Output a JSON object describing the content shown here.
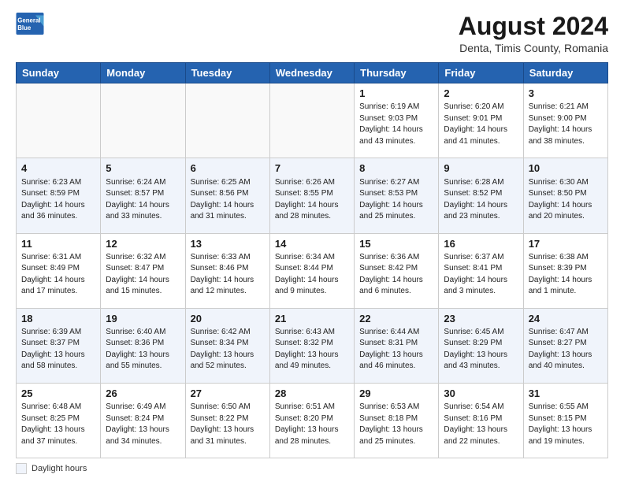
{
  "header": {
    "logo_line1": "General",
    "logo_line2": "Blue",
    "main_title": "August 2024",
    "subtitle": "Denta, Timis County, Romania"
  },
  "calendar": {
    "days_of_week": [
      "Sunday",
      "Monday",
      "Tuesday",
      "Wednesday",
      "Thursday",
      "Friday",
      "Saturday"
    ],
    "weeks": [
      [
        {
          "day": "",
          "info": ""
        },
        {
          "day": "",
          "info": ""
        },
        {
          "day": "",
          "info": ""
        },
        {
          "day": "",
          "info": ""
        },
        {
          "day": "1",
          "info": "Sunrise: 6:19 AM\nSunset: 9:03 PM\nDaylight: 14 hours\nand 43 minutes."
        },
        {
          "day": "2",
          "info": "Sunrise: 6:20 AM\nSunset: 9:01 PM\nDaylight: 14 hours\nand 41 minutes."
        },
        {
          "day": "3",
          "info": "Sunrise: 6:21 AM\nSunset: 9:00 PM\nDaylight: 14 hours\nand 38 minutes."
        }
      ],
      [
        {
          "day": "4",
          "info": "Sunrise: 6:23 AM\nSunset: 8:59 PM\nDaylight: 14 hours\nand 36 minutes."
        },
        {
          "day": "5",
          "info": "Sunrise: 6:24 AM\nSunset: 8:57 PM\nDaylight: 14 hours\nand 33 minutes."
        },
        {
          "day": "6",
          "info": "Sunrise: 6:25 AM\nSunset: 8:56 PM\nDaylight: 14 hours\nand 31 minutes."
        },
        {
          "day": "7",
          "info": "Sunrise: 6:26 AM\nSunset: 8:55 PM\nDaylight: 14 hours\nand 28 minutes."
        },
        {
          "day": "8",
          "info": "Sunrise: 6:27 AM\nSunset: 8:53 PM\nDaylight: 14 hours\nand 25 minutes."
        },
        {
          "day": "9",
          "info": "Sunrise: 6:28 AM\nSunset: 8:52 PM\nDaylight: 14 hours\nand 23 minutes."
        },
        {
          "day": "10",
          "info": "Sunrise: 6:30 AM\nSunset: 8:50 PM\nDaylight: 14 hours\nand 20 minutes."
        }
      ],
      [
        {
          "day": "11",
          "info": "Sunrise: 6:31 AM\nSunset: 8:49 PM\nDaylight: 14 hours\nand 17 minutes."
        },
        {
          "day": "12",
          "info": "Sunrise: 6:32 AM\nSunset: 8:47 PM\nDaylight: 14 hours\nand 15 minutes."
        },
        {
          "day": "13",
          "info": "Sunrise: 6:33 AM\nSunset: 8:46 PM\nDaylight: 14 hours\nand 12 minutes."
        },
        {
          "day": "14",
          "info": "Sunrise: 6:34 AM\nSunset: 8:44 PM\nDaylight: 14 hours\nand 9 minutes."
        },
        {
          "day": "15",
          "info": "Sunrise: 6:36 AM\nSunset: 8:42 PM\nDaylight: 14 hours\nand 6 minutes."
        },
        {
          "day": "16",
          "info": "Sunrise: 6:37 AM\nSunset: 8:41 PM\nDaylight: 14 hours\nand 3 minutes."
        },
        {
          "day": "17",
          "info": "Sunrise: 6:38 AM\nSunset: 8:39 PM\nDaylight: 14 hours\nand 1 minute."
        }
      ],
      [
        {
          "day": "18",
          "info": "Sunrise: 6:39 AM\nSunset: 8:37 PM\nDaylight: 13 hours\nand 58 minutes."
        },
        {
          "day": "19",
          "info": "Sunrise: 6:40 AM\nSunset: 8:36 PM\nDaylight: 13 hours\nand 55 minutes."
        },
        {
          "day": "20",
          "info": "Sunrise: 6:42 AM\nSunset: 8:34 PM\nDaylight: 13 hours\nand 52 minutes."
        },
        {
          "day": "21",
          "info": "Sunrise: 6:43 AM\nSunset: 8:32 PM\nDaylight: 13 hours\nand 49 minutes."
        },
        {
          "day": "22",
          "info": "Sunrise: 6:44 AM\nSunset: 8:31 PM\nDaylight: 13 hours\nand 46 minutes."
        },
        {
          "day": "23",
          "info": "Sunrise: 6:45 AM\nSunset: 8:29 PM\nDaylight: 13 hours\nand 43 minutes."
        },
        {
          "day": "24",
          "info": "Sunrise: 6:47 AM\nSunset: 8:27 PM\nDaylight: 13 hours\nand 40 minutes."
        }
      ],
      [
        {
          "day": "25",
          "info": "Sunrise: 6:48 AM\nSunset: 8:25 PM\nDaylight: 13 hours\nand 37 minutes."
        },
        {
          "day": "26",
          "info": "Sunrise: 6:49 AM\nSunset: 8:24 PM\nDaylight: 13 hours\nand 34 minutes."
        },
        {
          "day": "27",
          "info": "Sunrise: 6:50 AM\nSunset: 8:22 PM\nDaylight: 13 hours\nand 31 minutes."
        },
        {
          "day": "28",
          "info": "Sunrise: 6:51 AM\nSunset: 8:20 PM\nDaylight: 13 hours\nand 28 minutes."
        },
        {
          "day": "29",
          "info": "Sunrise: 6:53 AM\nSunset: 8:18 PM\nDaylight: 13 hours\nand 25 minutes."
        },
        {
          "day": "30",
          "info": "Sunrise: 6:54 AM\nSunset: 8:16 PM\nDaylight: 13 hours\nand 22 minutes."
        },
        {
          "day": "31",
          "info": "Sunrise: 6:55 AM\nSunset: 8:15 PM\nDaylight: 13 hours\nand 19 minutes."
        }
      ]
    ]
  },
  "footer": {
    "daylight_label": "Daylight hours"
  }
}
